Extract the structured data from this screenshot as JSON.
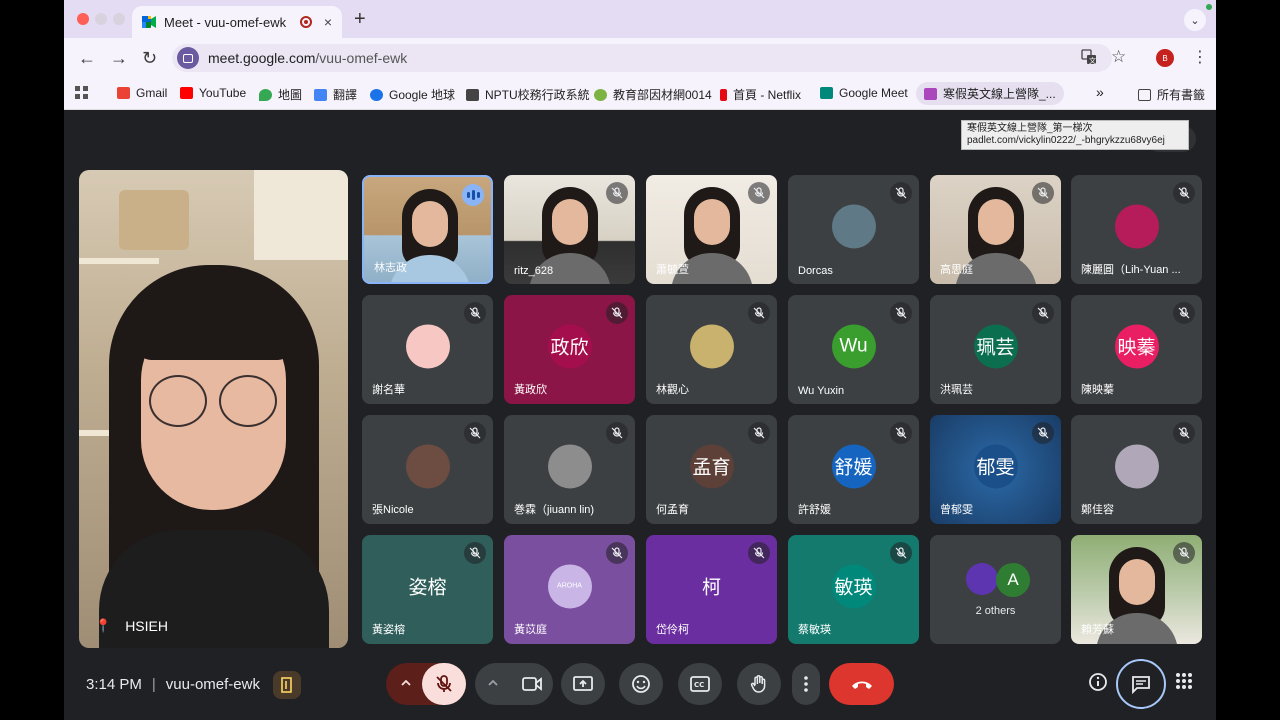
{
  "browser": {
    "tab_title": "Meet - vuu-omef-ewk",
    "url_host": "meet.google.com",
    "url_path": "/vuu-omef-ewk",
    "profile_initial": "B",
    "tab_close": "×",
    "new_tab": "+",
    "menu": "⌄"
  },
  "bookmarks": [
    {
      "label": "Gmail",
      "icon": "gmail-icon",
      "color": "#ea4335"
    },
    {
      "label": "YouTube",
      "icon": "youtube-icon",
      "color": "#ff0000"
    },
    {
      "label": "地圖",
      "icon": "maps-icon",
      "color": "#34a853"
    },
    {
      "label": "翻譯",
      "icon": "translate-icon",
      "color": "#4285f4"
    },
    {
      "label": "Google 地球",
      "icon": "earth-icon",
      "color": "#1a73e8"
    },
    {
      "label": "NPTU校務行政系統",
      "icon": "nptu-icon",
      "color": "#444444"
    },
    {
      "label": "教育部因材網0014",
      "icon": "adl-icon",
      "color": "#7cb342"
    },
    {
      "label": "首頁 - Netflix",
      "icon": "netflix-icon",
      "color": "#e50914"
    },
    {
      "label": "Google Meet",
      "icon": "meet-icon",
      "color": "#00897b"
    },
    {
      "label": "寒假英文線上營隊_...",
      "icon": "padlet-icon",
      "color": "#ab47bc"
    }
  ],
  "bookmarks_more": "»",
  "bookmarks_folder": "所有書籤",
  "tooltip": {
    "line1": "寒假英文線上營隊_第一梯次",
    "line2": "padlet.com/vickylin0222/_-bhgrykzzu68vy6ej"
  },
  "self_view": {
    "name": "HSIEH"
  },
  "participants": [
    {
      "name": "林志政",
      "type": "video",
      "speaking": true
    },
    {
      "name": "ritz_628",
      "type": "video"
    },
    {
      "name": "蕭毓萱",
      "type": "video"
    },
    {
      "name": "Dorcas",
      "type": "photo",
      "color": "#5f7a86"
    },
    {
      "name": "高思庭",
      "type": "video"
    },
    {
      "name": "陳麗圓（Lih-Yuan ...",
      "type": "photo",
      "color": "#b71c5a"
    },
    {
      "name": "謝名華",
      "type": "photo",
      "color": "#f6c7c3"
    },
    {
      "name": "黃政欣",
      "type": "initials",
      "initials": "政欣",
      "color": "#a50e4d"
    },
    {
      "name": "林觀心",
      "type": "photo",
      "color": "#c9b26e"
    },
    {
      "name": "Wu Yuxin",
      "type": "initials",
      "initials": "Wu",
      "color": "#3a9e2f"
    },
    {
      "name": "洪珮芸",
      "type": "initials",
      "initials": "珮芸",
      "color": "#0b6e4f"
    },
    {
      "name": "陳映蓁",
      "type": "initials",
      "initials": "映蓁",
      "color": "#e91e63"
    },
    {
      "name": "張Nicole",
      "type": "photo",
      "color": "#6d4c41"
    },
    {
      "name": "巻霖（jiuann lin)",
      "type": "photo",
      "color": "#8d8d8d"
    },
    {
      "name": "何孟育",
      "type": "initials",
      "initials": "孟育",
      "color": "#5d4037"
    },
    {
      "name": "許舒媛",
      "type": "initials",
      "initials": "舒媛",
      "color": "#1565c0"
    },
    {
      "name": "曾郁雯",
      "type": "initials",
      "initials": "郁雯",
      "color": "#1a4f8a"
    },
    {
      "name": "鄭佳容",
      "type": "photo",
      "color": "#b0a8b9"
    },
    {
      "name": "黃姿榕",
      "type": "initials",
      "initials": "姿榕",
      "color": "#2e6e6a"
    },
    {
      "name": "黃苡庭",
      "type": "photo",
      "initials": "AROHA",
      "color": "#b39ddb"
    },
    {
      "name": "岱伶柯",
      "type": "initials",
      "initials": "柯",
      "color": "#6a1b9a"
    },
    {
      "name": "蔡敏瑛",
      "type": "initials",
      "initials": "敏瑛",
      "color": "#00897b"
    },
    {
      "name": "2 others",
      "type": "others",
      "initials": "A",
      "color": "#2e7d32"
    },
    {
      "name": "賴芳蘇",
      "type": "video"
    }
  ],
  "bottom": {
    "time": "3:14 PM",
    "separator": "|",
    "meeting_code": "vuu-omef-ewk"
  },
  "colors": {
    "background": "#202124",
    "tile": "#3c4043",
    "end_call": "#dc362e",
    "mic_off": "#f9dedc",
    "accent_blue": "#8ab4f8"
  }
}
